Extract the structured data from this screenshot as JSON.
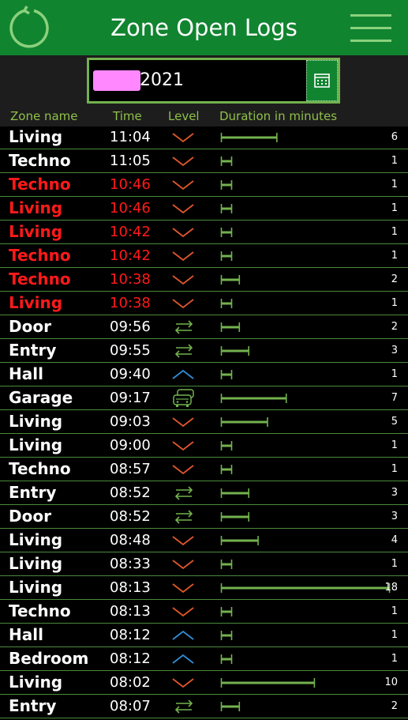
{
  "header": {
    "title": "Zone Open Logs"
  },
  "date": {
    "visible_text": "2021"
  },
  "columns": {
    "zone": "Zone name",
    "time": "Time",
    "level": "Level",
    "duration": "Duration in minutes"
  },
  "colors": {
    "header_bg": "#118430",
    "accent_green": "#73b24e",
    "alert_red": "#ff1a1a",
    "level_down": "#e0582a",
    "level_up": "#2f8ed8"
  },
  "max_duration": 18,
  "rows": [
    {
      "zone": "Living",
      "time": "11:04",
      "level": "chevron-down",
      "duration": 6,
      "alert": false
    },
    {
      "zone": "Techno",
      "time": "11:05",
      "level": "chevron-down",
      "duration": 1,
      "alert": false
    },
    {
      "zone": "Techno",
      "time": "10:46",
      "level": "chevron-down",
      "duration": 1,
      "alert": true
    },
    {
      "zone": "Living",
      "time": "10:46",
      "level": "chevron-down",
      "duration": 1,
      "alert": true
    },
    {
      "zone": "Living",
      "time": "10:42",
      "level": "chevron-down",
      "duration": 1,
      "alert": true
    },
    {
      "zone": "Techno",
      "time": "10:42",
      "level": "chevron-down",
      "duration": 1,
      "alert": true
    },
    {
      "zone": "Techno",
      "time": "10:38",
      "level": "chevron-down",
      "duration": 2,
      "alert": true
    },
    {
      "zone": "Living",
      "time": "10:38",
      "level": "chevron-down",
      "duration": 1,
      "alert": true
    },
    {
      "zone": "Door",
      "time": "09:56",
      "level": "swap",
      "duration": 2,
      "alert": false
    },
    {
      "zone": "Entry",
      "time": "09:55",
      "level": "swap",
      "duration": 3,
      "alert": false
    },
    {
      "zone": "Hall",
      "time": "09:40",
      "level": "chevron-up",
      "duration": 1,
      "alert": false
    },
    {
      "zone": "Garage",
      "time": "09:17",
      "level": "cars",
      "duration": 7,
      "alert": false
    },
    {
      "zone": "Living",
      "time": "09:03",
      "level": "chevron-down",
      "duration": 5,
      "alert": false
    },
    {
      "zone": "Living",
      "time": "09:00",
      "level": "chevron-down",
      "duration": 1,
      "alert": false
    },
    {
      "zone": "Techno",
      "time": "08:57",
      "level": "chevron-down",
      "duration": 1,
      "alert": false
    },
    {
      "zone": "Entry",
      "time": "08:52",
      "level": "swap",
      "duration": 3,
      "alert": false
    },
    {
      "zone": "Door",
      "time": "08:52",
      "level": "swap",
      "duration": 3,
      "alert": false
    },
    {
      "zone": "Living",
      "time": "08:48",
      "level": "chevron-down",
      "duration": 4,
      "alert": false
    },
    {
      "zone": "Living",
      "time": "08:33",
      "level": "chevron-down",
      "duration": 1,
      "alert": false
    },
    {
      "zone": "Living",
      "time": "08:13",
      "level": "chevron-down",
      "duration": 18,
      "alert": false
    },
    {
      "zone": "Techno",
      "time": "08:13",
      "level": "chevron-down",
      "duration": 1,
      "alert": false
    },
    {
      "zone": "Hall",
      "time": "08:12",
      "level": "chevron-up",
      "duration": 1,
      "alert": false
    },
    {
      "zone": "Bedroom",
      "time": "08:12",
      "level": "chevron-up",
      "duration": 1,
      "alert": false
    },
    {
      "zone": "Living",
      "time": "08:02",
      "level": "chevron-down",
      "duration": 10,
      "alert": false
    },
    {
      "zone": "Entry",
      "time": "08:07",
      "level": "swap",
      "duration": 2,
      "alert": false
    }
  ]
}
